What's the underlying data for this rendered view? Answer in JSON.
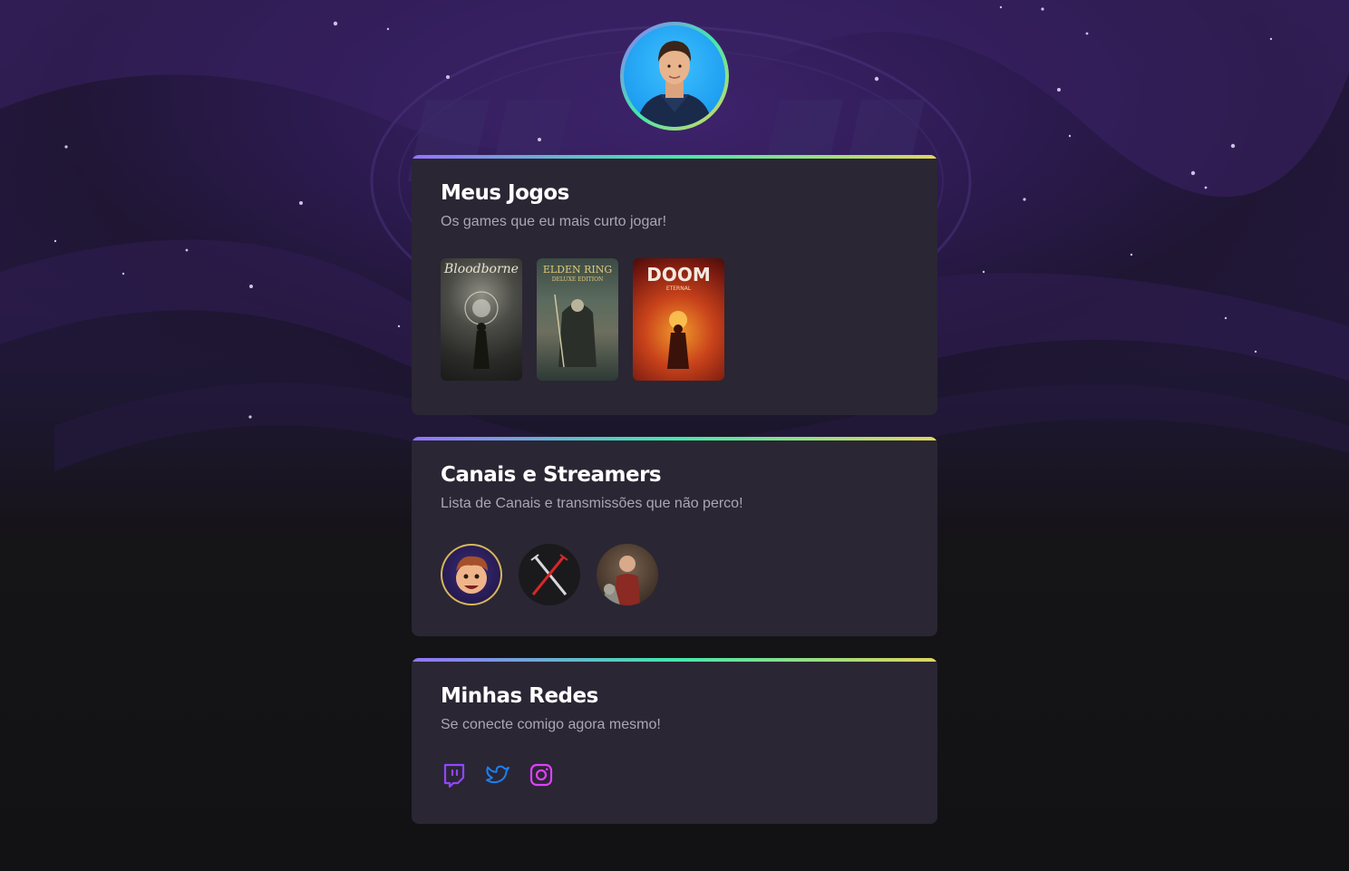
{
  "profile": {
    "avatar_alt": "avatar"
  },
  "games_section": {
    "title": "Meus Jogos",
    "subtitle": "Os games que eu mais curto jogar!",
    "games": [
      {
        "name": "Bloodborne",
        "icon": "bloodborne-cover"
      },
      {
        "name": "ELDEN RING",
        "edition": "DELUXE EDITION",
        "icon": "elden-ring-cover"
      },
      {
        "name": "DOOM",
        "tagline": "ETERNAL",
        "icon": "doom-eternal-cover"
      }
    ]
  },
  "channels_section": {
    "title": "Canais e Streamers",
    "subtitle": "Lista de Canais e transmissões que não perco!",
    "channels": [
      {
        "icon": "cartoon-streamer-avatar"
      },
      {
        "icon": "crossed-swords-avatar"
      },
      {
        "icon": "knight-cat-avatar"
      }
    ]
  },
  "social_section": {
    "title": "Minhas Redes",
    "subtitle": "Se conecte comigo agora mesmo!",
    "links": [
      {
        "icon": "twitch-icon",
        "color": "#9146ff"
      },
      {
        "icon": "twitter-icon",
        "color": "#1d9bf0"
      },
      {
        "icon": "instagram-icon",
        "color": "#e040fb"
      }
    ]
  },
  "colors": {
    "gradient": [
      "#9572fc",
      "#43e7ad",
      "#e1d55d"
    ],
    "card_bg": "#2a2634",
    "page_bg": "#121214",
    "text_muted": "#a8a8b3"
  }
}
